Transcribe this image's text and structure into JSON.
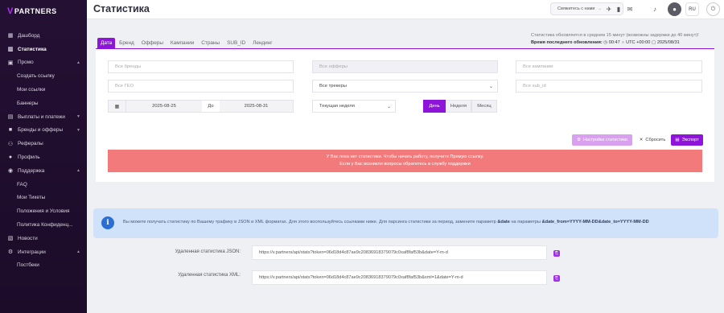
{
  "brand": {
    "logo_mark": "V",
    "logo_text": "PARTNERS"
  },
  "sidebar": {
    "items": [
      {
        "label": "Дашборд",
        "icon": "dashboard-icon"
      },
      {
        "label": "Статистика",
        "icon": "chart-icon"
      },
      {
        "label": "Промо",
        "icon": "promo-icon"
      },
      {
        "label": "Создать ссылку"
      },
      {
        "label": "Мои ссылки"
      },
      {
        "label": "Баннеры"
      },
      {
        "label": "Выплаты и платежи",
        "icon": "wallet-icon"
      },
      {
        "label": "Бренды и офферы",
        "icon": "briefcase-icon"
      },
      {
        "label": "Рефералы",
        "icon": "referrals-icon"
      },
      {
        "label": "Профиль",
        "icon": "user-icon"
      },
      {
        "label": "Поддержка",
        "icon": "support-icon"
      },
      {
        "label": "FAQ"
      },
      {
        "label": "Мои Тикеты"
      },
      {
        "label": "Положения и Условия"
      },
      {
        "label": "Политика Конфиденц..."
      },
      {
        "label": "Новости",
        "icon": "news-icon"
      },
      {
        "label": "Интеграции",
        "icon": "integrations-icon"
      },
      {
        "label": "Постбеки"
      }
    ]
  },
  "header": {
    "title": "Статистика",
    "contact_label": "Свяжитесь с нами",
    "lang": "RU"
  },
  "tabs": [
    "Дата",
    "Бренд",
    "Офферы",
    "Кампании",
    "Страны",
    "SUB_ID",
    "Лендинг"
  ],
  "stat_info": {
    "line1": "Статистика обновляется в среднем 15 минут (возможны задержки до 40 минут)!",
    "line2_label": "Время последнего обновления:",
    "time": "00:47",
    "timezone": "UTC +00:00",
    "date": "2025/08/31"
  },
  "filters": {
    "brands": "Все бренды",
    "offers": "Все офферы",
    "campaigns": "Все кампании",
    "geo": "Все ГЕО",
    "trackers": "Все трекеры",
    "sub_id": "Все sub_id",
    "date_from": "2025-08-25",
    "date_to_label": "До",
    "date_to": "2025-08-31",
    "period": "Текущая неделя",
    "granularity": [
      "День",
      "Неделя",
      "Месяц"
    ]
  },
  "actions": {
    "settings": "Настройки статистики",
    "reset": "Сбросить",
    "export": "Экспорт"
  },
  "alert": {
    "line1": "У Вас пока нет статистики. Чтобы начать работу, получите Прямую ссылку.",
    "line2": "Если у Вас возникли вопросы обратитесь в службу поддержки"
  },
  "info": {
    "text": "Вы можете получать статистику по Вашему трафику в JSON и XML форматах. Для этого воспользуйтесь ссылками ниже. Для парсинга статистики за период, замените параметр",
    "param1": "&date",
    "mid": "на параметры",
    "param2": "&date_from=YYYY-MM-DD&date_to=YYYY-MM-DD"
  },
  "api": {
    "json_label": "Удаленная статистика JSON:",
    "json_url": "https://v.partners/api/stats?token=06d18d4c87ae9c20836918379079c0xaf8faf53b&date=Y-m-d",
    "xml_label": "Удаленная статистика XML:",
    "xml_url": "https://v.partners/api/stats?token=06d18d4c87ae9c20836918379079c0xaf8faf53b&xml=1&date=Y-m-d"
  },
  "colors": {
    "accent": "#8e14d9",
    "alert": "#f27a7a",
    "info_bg": "#d0e1fa",
    "sidebar": "#241033"
  }
}
